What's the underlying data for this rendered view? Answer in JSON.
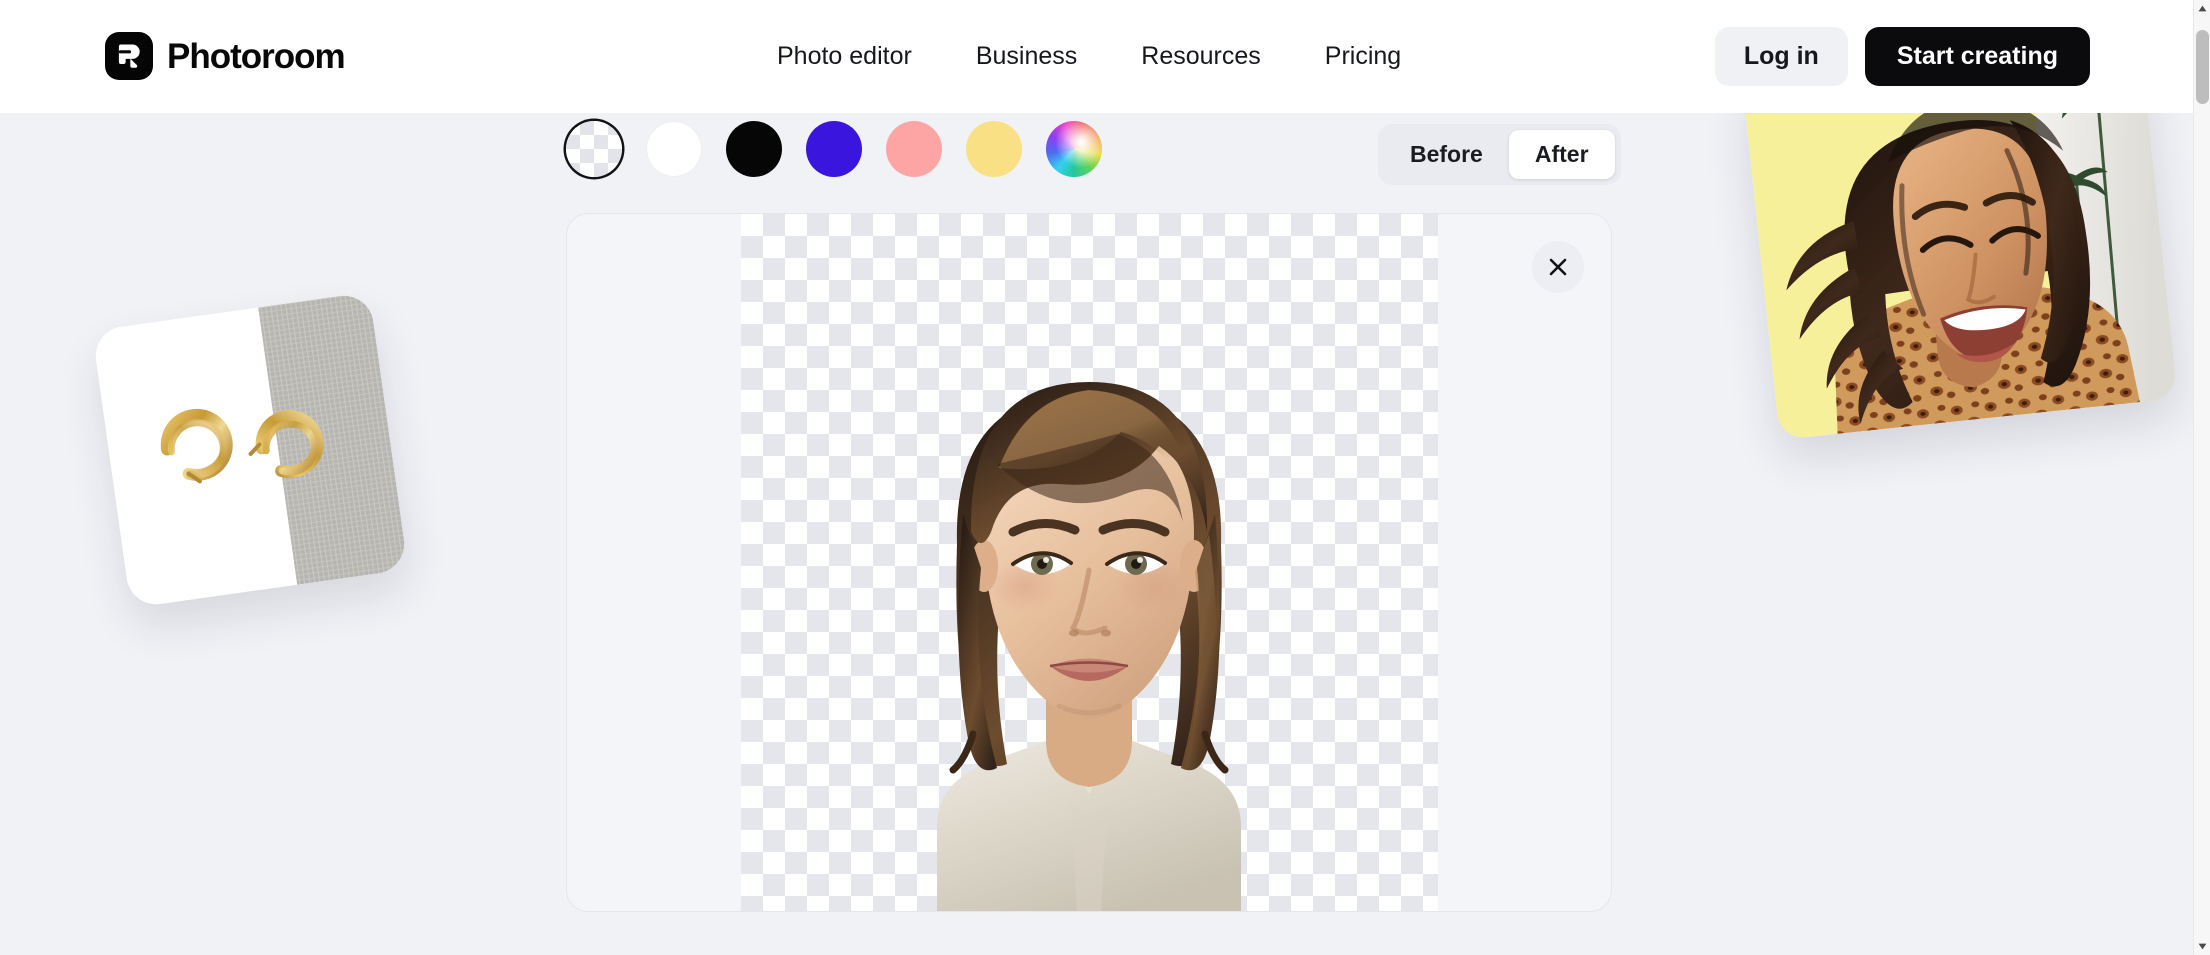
{
  "header": {
    "logo_icon": "photoroom-logo-icon",
    "brand": "Photoroom",
    "nav": [
      {
        "label": "Photo editor"
      },
      {
        "label": "Business"
      },
      {
        "label": "Resources"
      },
      {
        "label": "Pricing"
      }
    ],
    "login_label": "Log in",
    "start_label": "Start creating"
  },
  "toolbar": {
    "swatches": [
      {
        "name": "transparent",
        "label": "Transparent background",
        "color": "transparent",
        "selected": true
      },
      {
        "name": "white",
        "label": "White background",
        "color": "#ffffff",
        "selected": false
      },
      {
        "name": "black",
        "label": "Black background",
        "color": "#060606",
        "selected": false
      },
      {
        "name": "blue",
        "label": "Blue background",
        "color": "#3a15dd",
        "selected": false
      },
      {
        "name": "pink",
        "label": "Pink background",
        "color": "#fda5a5",
        "selected": false
      },
      {
        "name": "yellow",
        "label": "Yellow background",
        "color": "#f9e084",
        "selected": false
      },
      {
        "name": "custom",
        "label": "Custom color picker",
        "color": "rainbow",
        "selected": false
      }
    ],
    "before_label": "Before",
    "after_label": "After",
    "active_view": "After"
  },
  "canvas": {
    "close_icon": "close-icon",
    "background_state": "transparent-checkerboard",
    "subject_alt": "Portrait of a woman with shoulder-length brown hair, background removed"
  },
  "samples": {
    "left_card_alt": "Gold hoop earrings on a white and gray textured background",
    "right_card_alt": "Smiling woman on a yellow background with palm trees"
  },
  "scrollbar": {
    "up_icon": "scroll-up-arrow-icon",
    "down_icon": "scroll-down-arrow-icon",
    "thumb": "scrollbar-thumb"
  },
  "colors": {
    "page_background": "#f1f2f6",
    "header_background": "#ffffff",
    "accent_dark": "#0b0b0d",
    "canvas_background": "#f4f5f8",
    "checker_light": "#ffffff",
    "checker_dark": "#e4e6ec"
  }
}
